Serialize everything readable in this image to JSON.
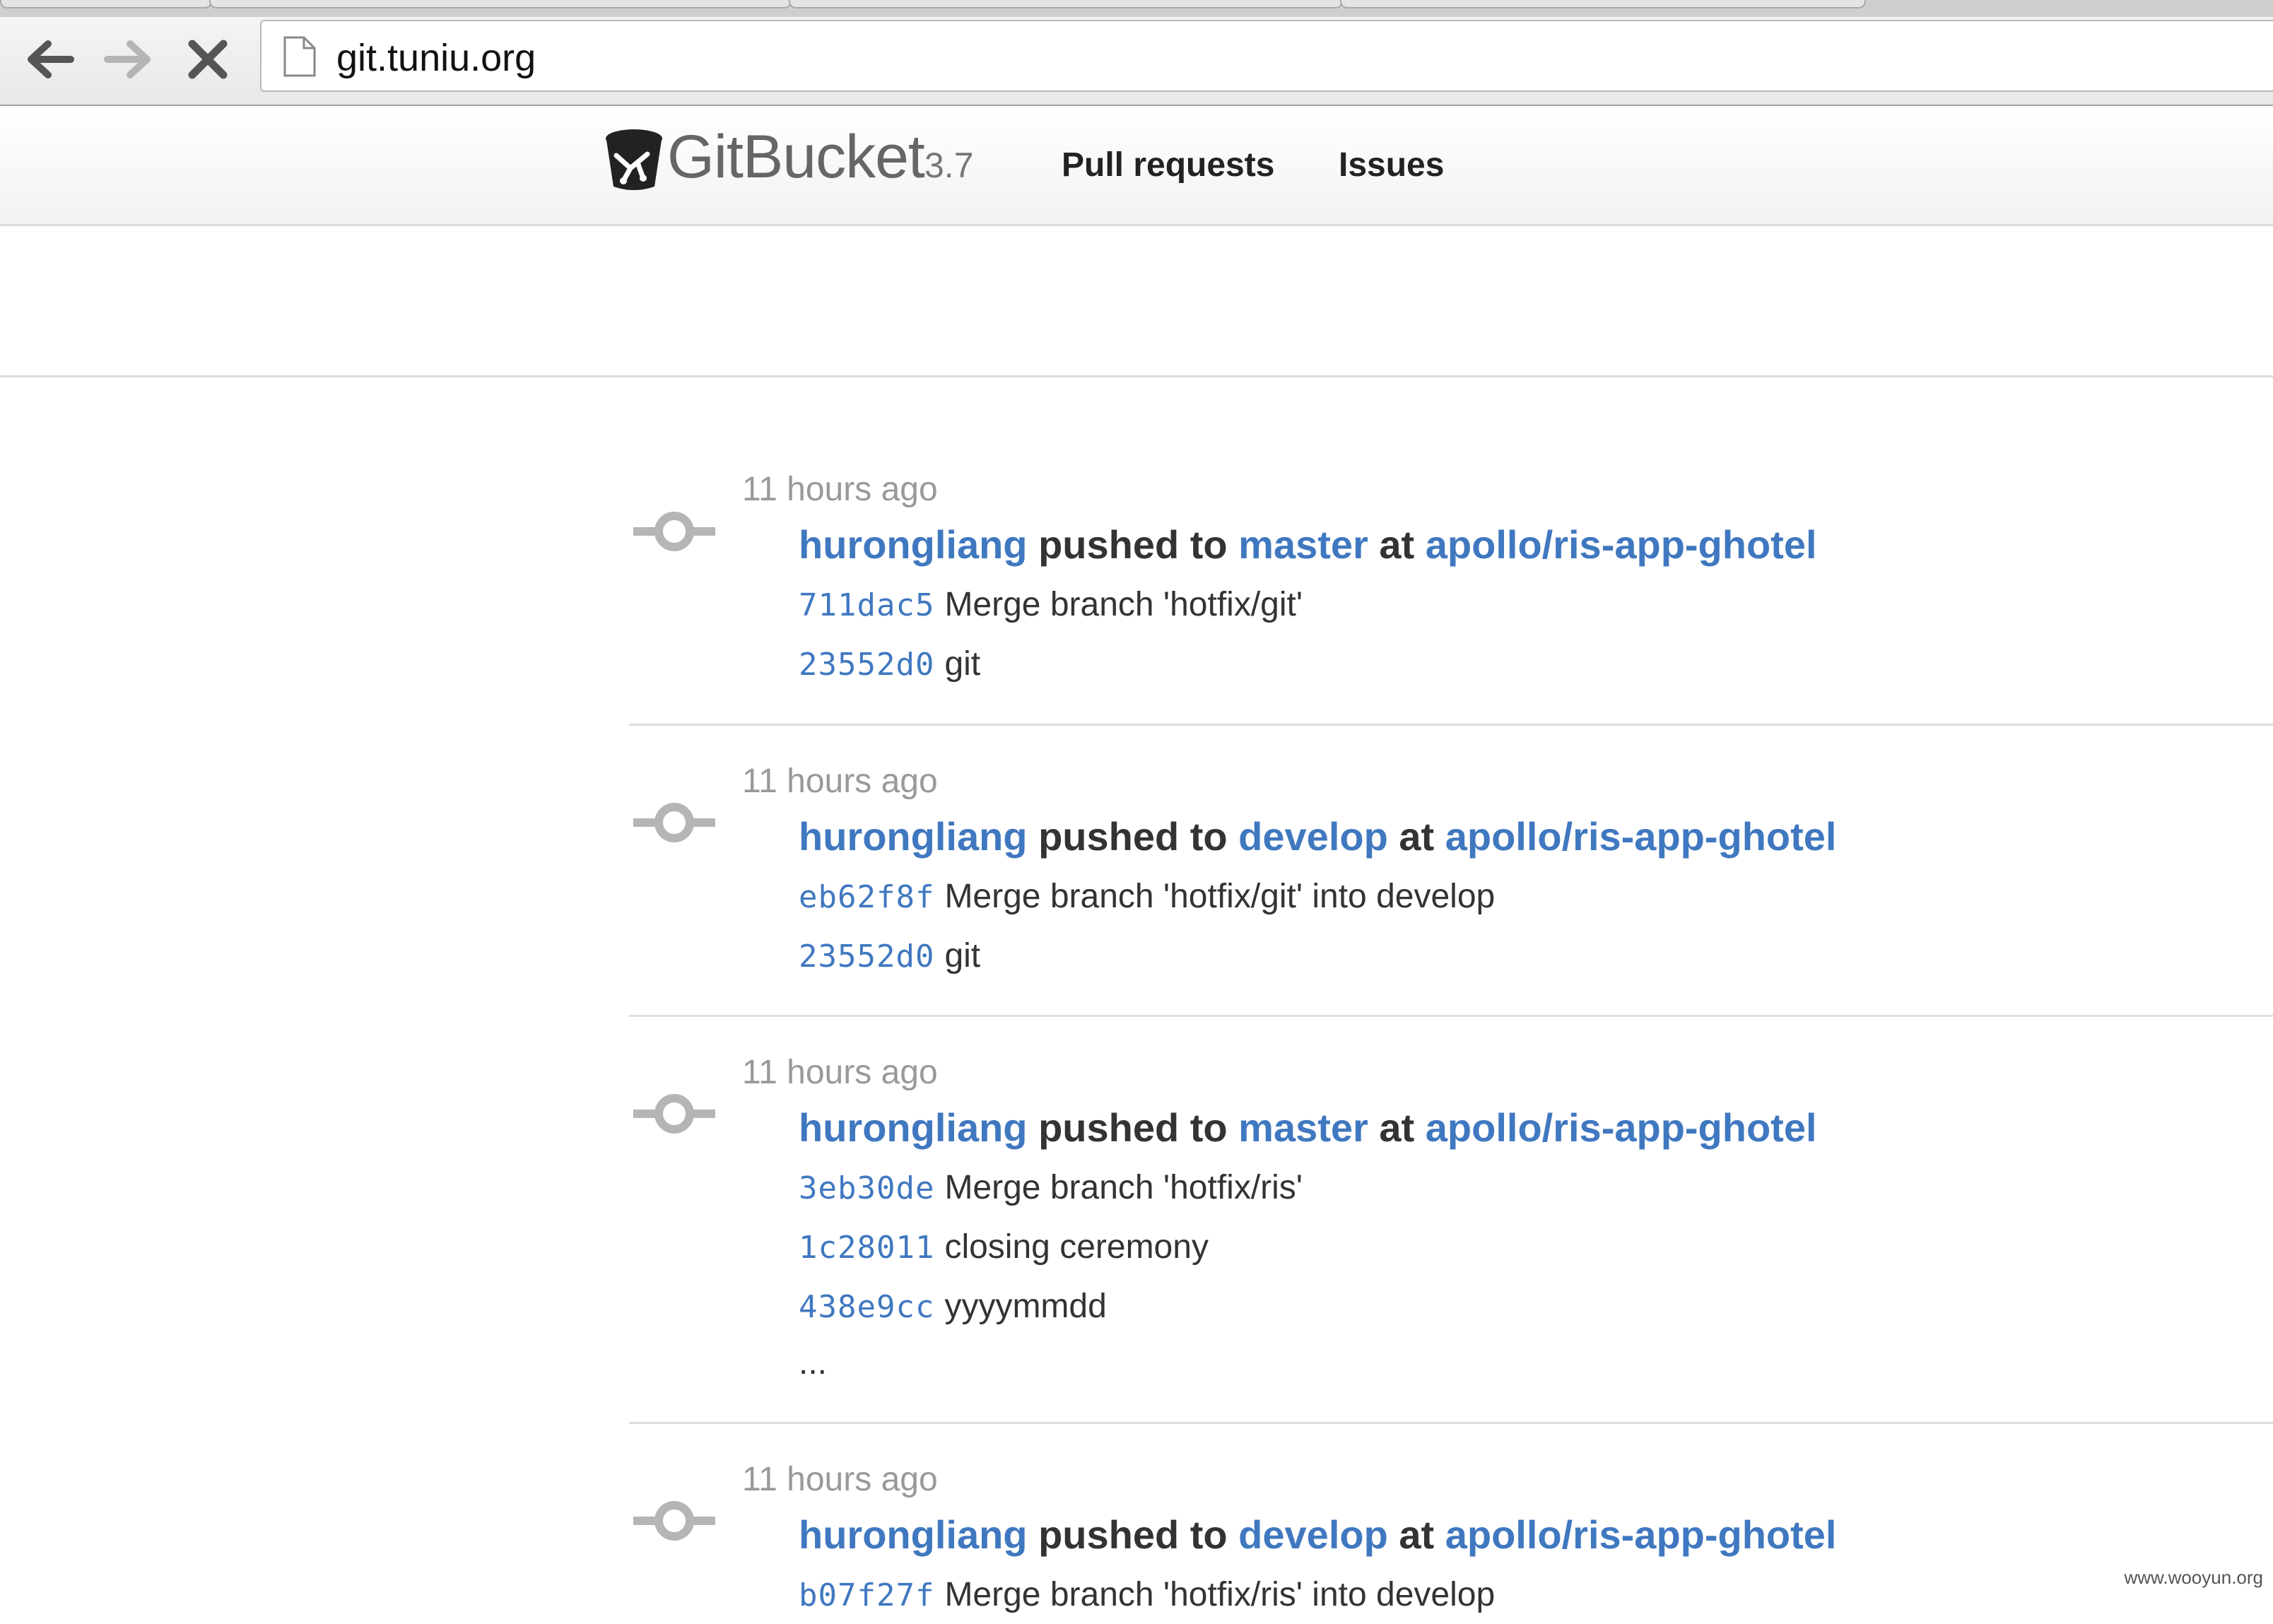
{
  "browser": {
    "url": "git.tuniu.org",
    "back_icon": "back-arrow-icon",
    "forward_icon": "forward-arrow-icon",
    "stop_icon": "stop-x-icon",
    "page_icon": "page-document-icon"
  },
  "header": {
    "brand": "GitBucket",
    "version": "3.7",
    "nav": [
      "Pull requests",
      "Issues"
    ]
  },
  "feed": [
    {
      "time": "11 hours ago",
      "user": "hurongliang",
      "action": "pushed to",
      "branch": "master",
      "at": "at",
      "repo": "apollo/ris-app-ghotel",
      "commits": [
        {
          "sha": "711dac5",
          "message": "Merge branch 'hotfix/git'"
        },
        {
          "sha": "23552d0",
          "message": "git"
        }
      ]
    },
    {
      "time": "11 hours ago",
      "user": "hurongliang",
      "action": "pushed to",
      "branch": "develop",
      "at": "at",
      "repo": "apollo/ris-app-ghotel",
      "commits": [
        {
          "sha": "eb62f8f",
          "message": "Merge branch 'hotfix/git' into develop"
        },
        {
          "sha": "23552d0",
          "message": "git"
        }
      ]
    },
    {
      "time": "11 hours ago",
      "user": "hurongliang",
      "action": "pushed to",
      "branch": "master",
      "at": "at",
      "repo": "apollo/ris-app-ghotel",
      "commits": [
        {
          "sha": "3eb30de",
          "message": "Merge branch 'hotfix/ris'"
        },
        {
          "sha": "1c28011",
          "message": "closing ceremony"
        },
        {
          "sha": "438e9cc",
          "message": "yyyymmdd"
        }
      ],
      "more": "..."
    },
    {
      "time": "11 hours ago",
      "user": "hurongliang",
      "action": "pushed to",
      "branch": "develop",
      "at": "at",
      "repo": "apollo/ris-app-ghotel",
      "commits": [
        {
          "sha": "b07f27f",
          "message": "Merge branch 'hotfix/ris' into develop"
        }
      ]
    }
  ],
  "colors": {
    "link": "#4078c0",
    "muted": "#999999",
    "text": "#333333"
  },
  "watermark": "www.wooyun.org"
}
